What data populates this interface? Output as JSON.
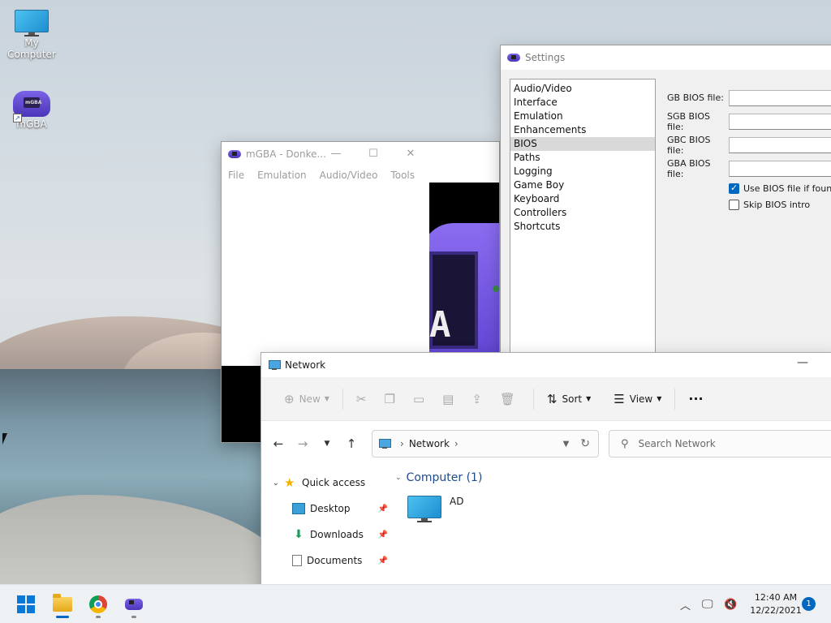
{
  "desktop": {
    "icons": [
      {
        "label": "My Computer",
        "icon": "monitor-icon"
      },
      {
        "label": "mGBA",
        "icon": "gba-icon"
      }
    ]
  },
  "mgba_window": {
    "title": "mGBA - Donke...",
    "menu": [
      "File",
      "Emulation",
      "Audio/Video",
      "Tools"
    ],
    "controls": {
      "minimize": "—",
      "maximize": "☐",
      "close": "✕"
    },
    "screen_letter": "A"
  },
  "settings_window": {
    "title": "Settings",
    "nav_items": [
      "Audio/Video",
      "Interface",
      "Emulation",
      "Enhancements",
      "BIOS",
      "Paths",
      "Logging",
      "Game Boy",
      "Keyboard",
      "Controllers",
      "Shortcuts"
    ],
    "selected_nav": "BIOS",
    "bios_fields": [
      {
        "label": "GB BIOS file:",
        "value": ""
      },
      {
        "label": "SGB BIOS file:",
        "value": ""
      },
      {
        "label": "GBC BIOS file:",
        "value": ""
      },
      {
        "label": "GBA BIOS file:",
        "value": ""
      }
    ],
    "checkboxes": [
      {
        "label": "Use BIOS file if found",
        "checked": true
      },
      {
        "label": "Skip BIOS intro",
        "checked": false
      }
    ]
  },
  "explorer": {
    "title": "Network",
    "minimize": "—",
    "ribbon": {
      "new_label": "New",
      "sort_label": "Sort",
      "view_label": "View",
      "more_label": "···"
    },
    "address": {
      "location": "Network",
      "separator": "›"
    },
    "search_placeholder": "Search Network",
    "nav": {
      "quick_access": "Quick access",
      "items": [
        {
          "label": "Desktop",
          "icon": "desktop-folder-icon"
        },
        {
          "label": "Downloads",
          "icon": "download-icon"
        },
        {
          "label": "Documents",
          "icon": "document-icon"
        }
      ]
    },
    "group": {
      "header": "Computer (1)",
      "items": [
        {
          "name": "AD",
          "icon": "computer-icon"
        }
      ]
    }
  },
  "taskbar": {
    "time": "12:40 AM",
    "date": "12/22/2021",
    "notification_count": "1",
    "colors": {
      "accent": "#0067c0"
    }
  }
}
